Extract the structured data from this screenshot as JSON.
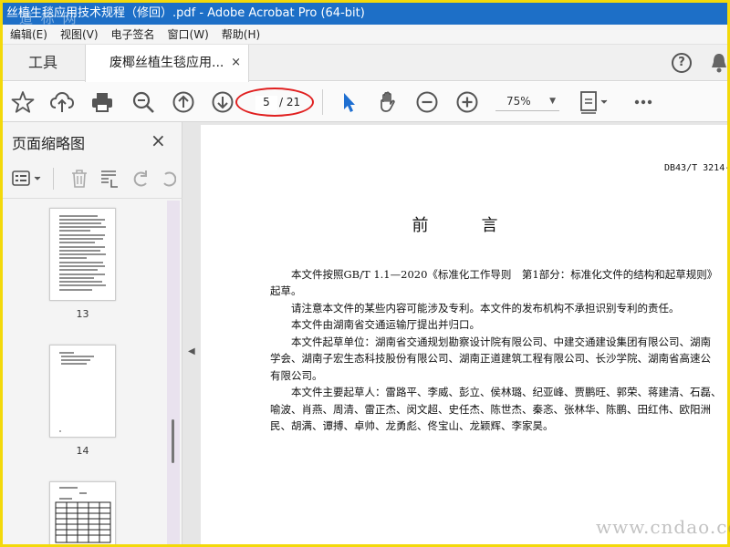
{
  "window": {
    "title": "丝植生毯应用技术规程（修回）.pdf - Adobe Acrobat Pro (64-bit)",
    "watermark_top": "道 标 网",
    "watermark_bottom": "www.cndao.com"
  },
  "menu": [
    "编辑(E)",
    "视图(V)",
    "电子签名",
    "窗口(W)",
    "帮助(H)"
  ],
  "tabs": {
    "tools_label": "工具",
    "doc_label": "废椰丝植生毯应用...",
    "close_glyph": "×",
    "help_glyph": "?"
  },
  "toolbar": {
    "current_page": "5",
    "total_pages": "/ 21",
    "zoom": "75%",
    "icons": [
      "star-icon",
      "cloud-upload-icon",
      "print-icon",
      "zoom-search-icon",
      "page-up-icon",
      "page-down-icon",
      "select-cursor-icon",
      "hand-icon",
      "zoom-out-icon",
      "zoom-in-icon",
      "fit-page-icon",
      "more-icon"
    ]
  },
  "left_panel": {
    "title": "页面缩略图",
    "close_glyph": "×",
    "thumbnails": [
      {
        "label": "13"
      },
      {
        "label": "14"
      },
      {
        "label": ""
      }
    ]
  },
  "document": {
    "doc_number": "DB43/T 3214-",
    "heading": "前　言",
    "paragraphs": [
      "　　本文件按照GB/T 1.1—2020《标准化工作导则　第1部分：标准化文件的结构和起草规则》",
      "起草。",
      "　　请注意本文件的某些内容可能涉及专利。本文件的发布机构不承担识别专利的责任。",
      "　　本文件由湖南省交通运输厅提出并归口。",
      "　　本文件起草单位：湖南省交通规划勘察设计院有限公司、中建交通建设集团有限公司、湖南",
      "学会、湖南子宏生态科技股份有限公司、湖南正道建筑工程有限公司、长沙学院、湖南省高速公",
      "有限公司。",
      "　　本文件主要起草人：雷路平、李威、彭立、侯林璐、纪亚峰、贾鹏旺、郭荣、蒋建清、石磊、",
      "喻波、肖燕、周清、雷正杰、闵文超、史任杰、陈世杰、秦忞、张林华、陈鹏、田红伟、欧阳洲",
      "民、胡满、谭搏、卓帅、龙勇彪、佟宝山、龙颖辉、李家昊。"
    ]
  },
  "colors": {
    "title_bar": "#1d6fc7",
    "frame": "#f3d90a",
    "annotation": "#e02020",
    "select_cursor": "#1f6fd1"
  }
}
